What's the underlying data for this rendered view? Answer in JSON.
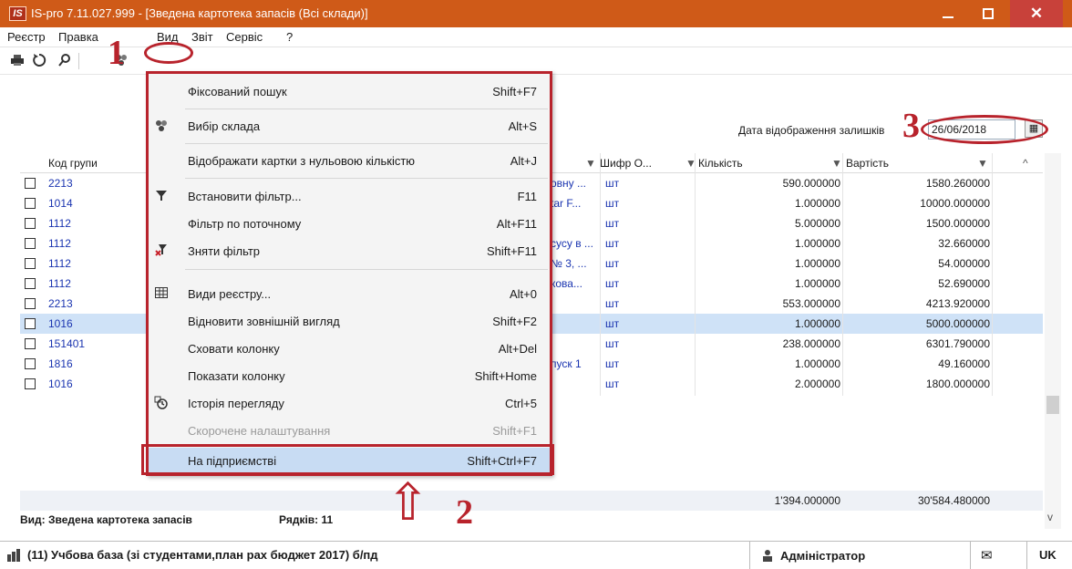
{
  "window": {
    "logo": "IS",
    "title": "IS-pro 7.11.027.999 - [Зведена картотека запасів (Всі склади)]",
    "min": "_",
    "close": "✕"
  },
  "menu": [
    "Реєстр",
    "Правка",
    "Вид",
    "Звіт",
    "Сервіс",
    "?"
  ],
  "toolbar": {
    "icons": [
      "print-icon",
      "refresh-icon",
      "search-icon",
      "warehouse-icon"
    ]
  },
  "date": {
    "label": "Дата відображення залишків",
    "value": "26/06/2018"
  },
  "table": {
    "headers": {
      "code": "Код групи",
      "unit": "Шифр О...",
      "qty": "Кількість",
      "value": "Вартість"
    },
    "rows": [
      {
        "code": "2213",
        "name": "овну ...",
        "unit": "шт",
        "qty": "590.000000",
        "value": "1580.260000"
      },
      {
        "code": "1014",
        "name": "tar F...",
        "unit": "шт",
        "qty": "1.000000",
        "value": "10000.000000"
      },
      {
        "code": "1112",
        "name": "",
        "unit": "шт",
        "qty": "5.000000",
        "value": "1500.000000"
      },
      {
        "code": "1112",
        "name": "сусу в ...",
        "unit": "шт",
        "qty": "1.000000",
        "value": "32.660000"
      },
      {
        "code": "1112",
        "name": "№ 3, ...",
        "unit": "шт",
        "qty": "1.000000",
        "value": "54.000000"
      },
      {
        "code": "1112",
        "name": "кова...",
        "unit": "шт",
        "qty": "1.000000",
        "value": "52.690000"
      },
      {
        "code": "2213",
        "name": "",
        "unit": "шт",
        "qty": "553.000000",
        "value": "4213.920000"
      },
      {
        "code": "1016",
        "name": "",
        "unit": "шт",
        "qty": "1.000000",
        "value": "5000.000000"
      },
      {
        "code": "151401",
        "name": "",
        "unit": "шт",
        "qty": "238.000000",
        "value": "6301.790000"
      },
      {
        "code": "1816",
        "name": "пуск 1",
        "unit": "шт",
        "qty": "1.000000",
        "value": "49.160000"
      },
      {
        "code": "1016",
        "name": "",
        "unit": "шт",
        "qty": "2.000000",
        "value": "1800.000000"
      }
    ],
    "totals": {
      "qty": "1'394.000000",
      "value": "30'584.480000"
    }
  },
  "status": {
    "view": "Вид: Зведена картотека запасів",
    "rows": "Рядків: 11"
  },
  "bottom": {
    "db": "(11) Учбова база (зі студентами,план рах бюджет 2017) б/пд",
    "user": "Адміністратор",
    "lang": "UK"
  },
  "dropdown": [
    {
      "label": "Фіксований пошук",
      "shortcut": "Shift+F7",
      "icon": ""
    },
    {
      "label": "Вибір склада",
      "shortcut": "Alt+S",
      "icon": "warehouse-icon"
    },
    {
      "label": "Відображати картки з нульовою кількістю",
      "shortcut": "Alt+J",
      "icon": ""
    },
    {
      "label": "Встановити фільтр...",
      "shortcut": "F11",
      "icon": "filter-icon"
    },
    {
      "label": "Фільтр по поточному",
      "shortcut": "Alt+F11",
      "icon": ""
    },
    {
      "label": "Зняти фільтр",
      "shortcut": "Shift+F11",
      "icon": "remove-filter-icon"
    },
    {
      "label": "Види реєстру...",
      "shortcut": "Alt+0",
      "icon": "table-icon"
    },
    {
      "label": "Відновити зовнішній вигляд",
      "shortcut": "Shift+F2",
      "icon": ""
    },
    {
      "label": "Сховати колонку",
      "shortcut": "Alt+Del",
      "icon": ""
    },
    {
      "label": "Показати колонку",
      "shortcut": "Shift+Home",
      "icon": ""
    },
    {
      "label": "Історія перегляду",
      "shortcut": "Ctrl+5",
      "icon": "history-icon"
    },
    {
      "label": "Скорочене налаштування",
      "shortcut": "Shift+F1",
      "icon": ""
    },
    {
      "label": "На підприємстві",
      "shortcut": "Shift+Ctrl+F7",
      "icon": ""
    }
  ],
  "annotations": {
    "one": "1",
    "two": "2",
    "three": "3",
    "arrow": "⇧"
  }
}
